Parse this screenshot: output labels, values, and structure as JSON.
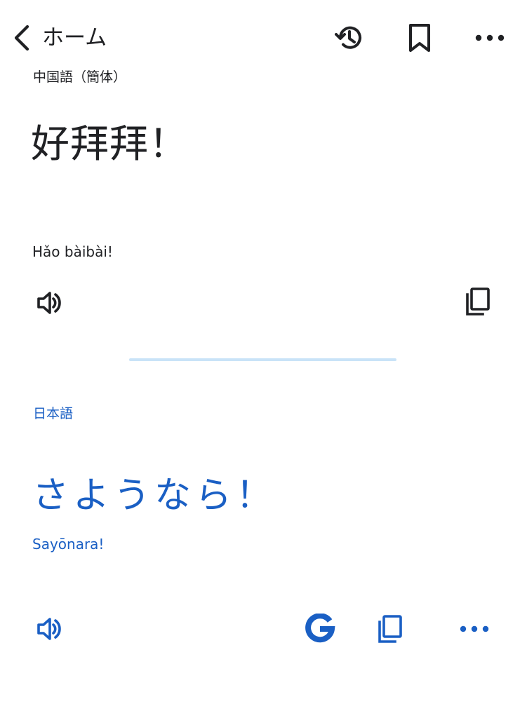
{
  "header": {
    "back_label": "ホーム"
  },
  "source": {
    "language": "中国語（簡体）",
    "text": "好拜拜！",
    "transliteration": "Hǎo bàibài!"
  },
  "target": {
    "language": "日本語",
    "text": "さようなら！",
    "transliteration": "Sayōnara!"
  },
  "icons": {
    "back": "chevron-left-icon",
    "history": "history-icon",
    "bookmark": "bookmark-icon",
    "more": "more-horizontal-icon",
    "speak": "speaker-icon",
    "copy": "copy-icon",
    "google": "google-g-icon"
  },
  "colors": {
    "text_primary": "#202124",
    "accent_blue": "#1a5fc4",
    "divider": "#c9e3f8"
  }
}
